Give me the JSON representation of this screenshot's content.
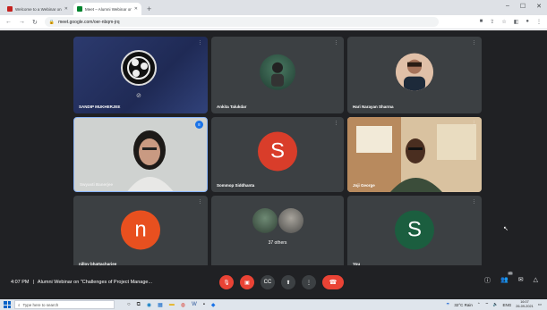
{
  "browser": {
    "tabs": [
      {
        "title": "Welcome to a Webinar on Follo",
        "active": false,
        "favicon_color": "#c5221f"
      },
      {
        "title": "Meet – Alumni Webinar on",
        "active": true,
        "favicon_color": "#00832d"
      }
    ],
    "new_tab_label": "+",
    "url": "meet.google.com/oer-nbqm-jrq"
  },
  "meet": {
    "tiles": [
      {
        "name": "SANDIP MUKHERJEE",
        "type": "obs"
      },
      {
        "name": "Ankita Talukdar",
        "type": "photo",
        "color": "#2f5f4f"
      },
      {
        "name": "Hari Narayan Sharma",
        "type": "photo",
        "color": "#c78a6b"
      },
      {
        "name": "Swyasti Banerjee",
        "type": "video"
      },
      {
        "name": "Sommop Siddhanta",
        "type": "letter",
        "letter": "S",
        "color": "#d93d2a"
      },
      {
        "name": "Joji George",
        "type": "video2"
      },
      {
        "name": "nilloy bhattacharjee",
        "type": "letter",
        "letter": "n",
        "color": "#e8501f"
      },
      {
        "name": "",
        "type": "others",
        "others_label": "37 others"
      },
      {
        "name": "You",
        "type": "letter",
        "letter": "S",
        "color": "#1b5e3f"
      }
    ],
    "bottom": {
      "time": "4:07 PM",
      "separator": "|",
      "meeting_title": "Alumni Webinar on \"Challenges of Project Manage...",
      "participant_count": "43"
    }
  },
  "taskbar": {
    "search_placeholder": "Type here to search",
    "weather": "32°C Rain",
    "language": "ENG",
    "clock_time": "16:07",
    "clock_date": "26-09-2021"
  }
}
